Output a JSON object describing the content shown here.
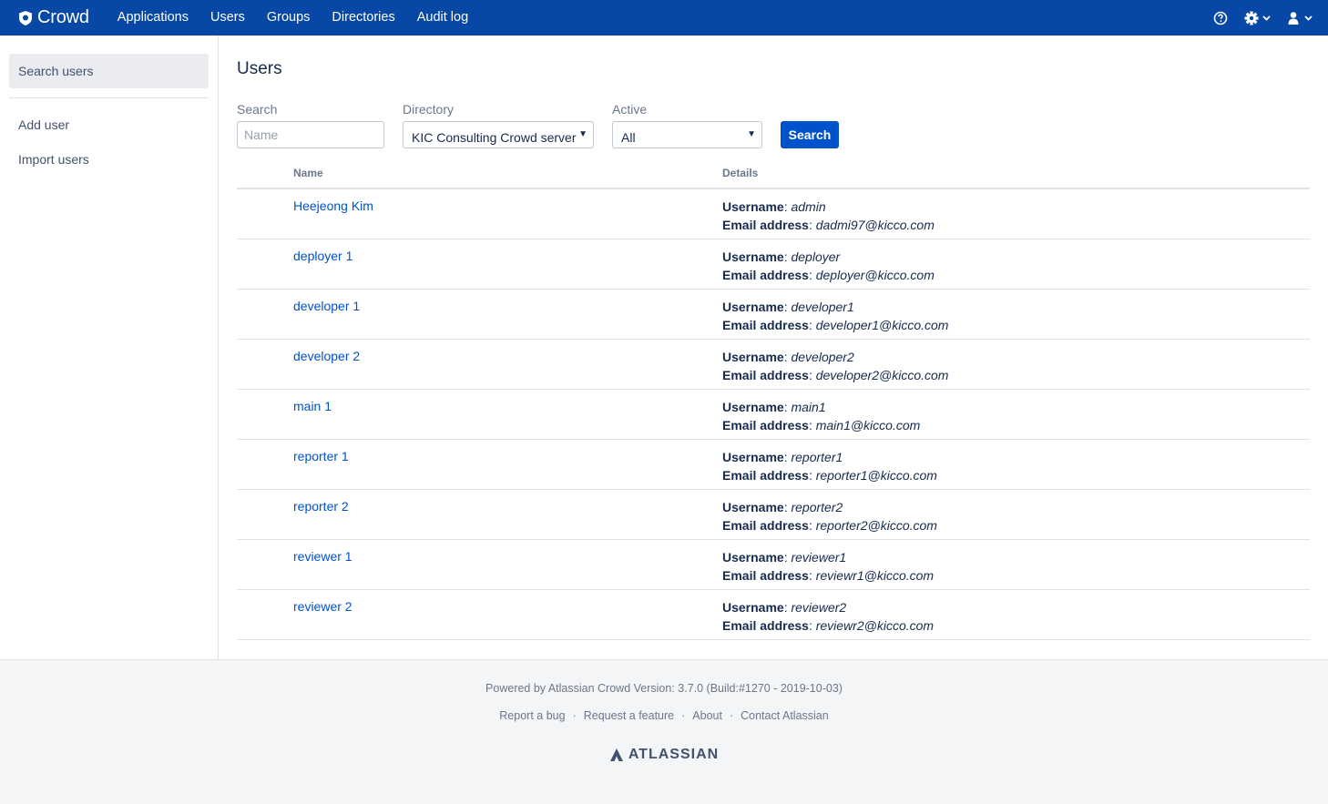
{
  "header": {
    "logo_text": "Crowd",
    "nav": [
      "Applications",
      "Users",
      "Groups",
      "Directories",
      "Audit log"
    ],
    "icons": [
      "help-icon",
      "settings-icon",
      "user-icon"
    ]
  },
  "sidebar": {
    "active": "Search users",
    "items": [
      "Add user",
      "Import users"
    ]
  },
  "main": {
    "title": "Users",
    "search": {
      "label": "Search",
      "placeholder": "Name",
      "value": ""
    },
    "directory": {
      "label": "Directory",
      "value": "KIC Consulting Crowd server"
    },
    "active": {
      "label": "Active",
      "value": "All"
    },
    "search_button": "Search",
    "table": {
      "col_name": "Name",
      "col_details": "Details",
      "username_label": "Username",
      "email_label": "Email address",
      "rows": [
        {
          "name": "Heejeong Kim",
          "username": "admin",
          "email": "dadmi97@kicco.com"
        },
        {
          "name": "deployer 1",
          "username": "deployer",
          "email": "deployer@kicco.com"
        },
        {
          "name": "developer 1",
          "username": "developer1",
          "email": "developer1@kicco.com"
        },
        {
          "name": "developer 2",
          "username": "developer2",
          "email": "developer2@kicco.com"
        },
        {
          "name": "main 1",
          "username": "main1",
          "email": "main1@kicco.com"
        },
        {
          "name": "reporter 1",
          "username": "reporter1",
          "email": "reporter1@kicco.com"
        },
        {
          "name": "reporter 2",
          "username": "reporter2",
          "email": "reporter2@kicco.com"
        },
        {
          "name": "reviewer 1",
          "username": "reviewer1",
          "email": "reviewr1@kicco.com"
        },
        {
          "name": "reviewer 2",
          "username": "reviewer2",
          "email": "reviewr2@kicco.com"
        }
      ]
    }
  },
  "footer": {
    "powered": "Powered by Atlassian Crowd Version: 3.7.0 (Build:#1270 - 2019-10-03)",
    "links": [
      "Report a bug",
      "Request a feature",
      "About",
      "Contact Atlassian"
    ],
    "brand": "ATLASSIAN"
  },
  "colors": {
    "topbar": "#0747a6",
    "link": "#0052cc",
    "button": "#0052cc"
  }
}
